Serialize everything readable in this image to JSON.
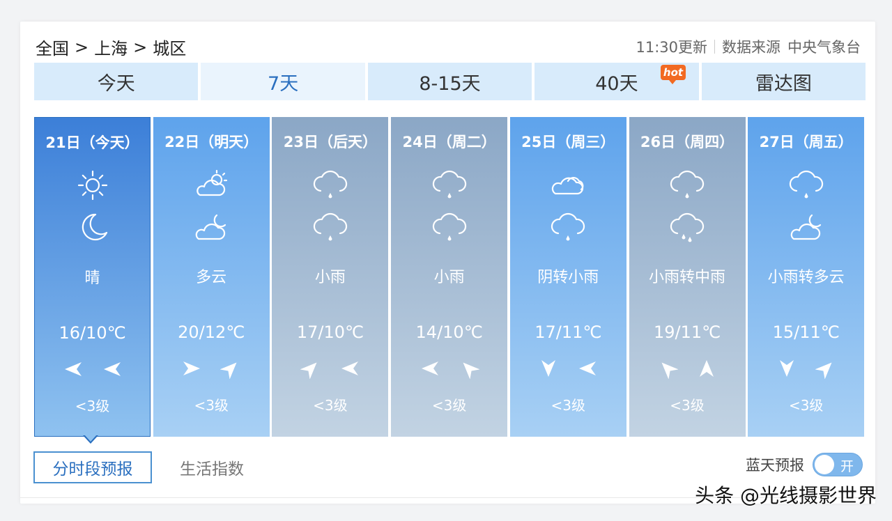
{
  "breadcrumb": {
    "country": "全国",
    "city": "上海",
    "district": "城区",
    "sep1": ">",
    "sep2": ">"
  },
  "update": {
    "time": "11:30更新",
    "source_label": "数据来源",
    "source_name": "中央气象台"
  },
  "tabs": [
    {
      "label": "今天"
    },
    {
      "label": "7天"
    },
    {
      "label": "8-15天"
    },
    {
      "label": "40天"
    },
    {
      "label": "雷达图"
    }
  ],
  "hot_badge": "hot",
  "days": [
    {
      "date": "21日（今天）",
      "day_icon": "sun-icon",
      "night_icon": "moon-icon",
      "desc": "晴",
      "temp": "16/10℃",
      "wind1": "west-wind-icon",
      "wind2": "west-wind-icon",
      "level": "<3级",
      "bg": "#3d7fd8"
    },
    {
      "date": "22日（明天）",
      "day_icon": "partly-cloudy-day-icon",
      "night_icon": "partly-cloudy-night-icon",
      "desc": "多云",
      "temp": "20/12℃",
      "wind1": "east-wind-icon",
      "wind2": "northeast-wind-icon",
      "level": "<3级",
      "bg": "#62a6ee"
    },
    {
      "date": "23日（后天）",
      "day_icon": "rain-icon",
      "night_icon": "rain-icon",
      "desc": "小雨",
      "temp": "17/10℃",
      "wind1": "northeast-wind-icon",
      "wind2": "west-wind-icon",
      "level": "<3级",
      "bg": "#8eaac8"
    },
    {
      "date": "24日（周二）",
      "day_icon": "rain-icon",
      "night_icon": "rain-icon",
      "desc": "小雨",
      "temp": "14/10℃",
      "wind1": "west-wind-icon",
      "wind2": "northwest-wind-icon",
      "level": "<3级",
      "bg": "#8eaac8"
    },
    {
      "date": "25日（周三）",
      "day_icon": "cloudy-icon",
      "night_icon": "rain-icon",
      "desc": "阴转小雨",
      "temp": "17/11℃",
      "wind1": "south-wind-icon",
      "wind2": "west-wind-icon",
      "level": "<3级",
      "bg": "#62a6ee"
    },
    {
      "date": "26日（周四）",
      "day_icon": "rain-icon",
      "night_icon": "moderate-rain-icon",
      "desc": "小雨转中雨",
      "temp": "19/11℃",
      "wind1": "northwest-wind-icon",
      "wind2": "north-wind-icon",
      "level": "<3级",
      "bg": "#8eaac8"
    },
    {
      "date": "27日（周五）",
      "day_icon": "rain-icon",
      "night_icon": "partly-cloudy-night-icon",
      "desc": "小雨转多云",
      "temp": "15/11℃",
      "wind1": "south-wind-icon",
      "wind2": "northeast-wind-icon",
      "level": "<3级",
      "bg": "#62a6ee"
    }
  ],
  "subtabs": {
    "hourly": "分时段预报",
    "life": "生活指数"
  },
  "bluesky": {
    "label": "蓝天预报",
    "toggle": "开"
  },
  "watermark": "头条 @光线摄影世界",
  "colors": {
    "accent": "#2a6fbf",
    "tab_bg": "#d8ebfb",
    "today_bg": "#3d7fd8",
    "grey_day": "#8eaac8",
    "blue_day": "#62a6ee"
  }
}
